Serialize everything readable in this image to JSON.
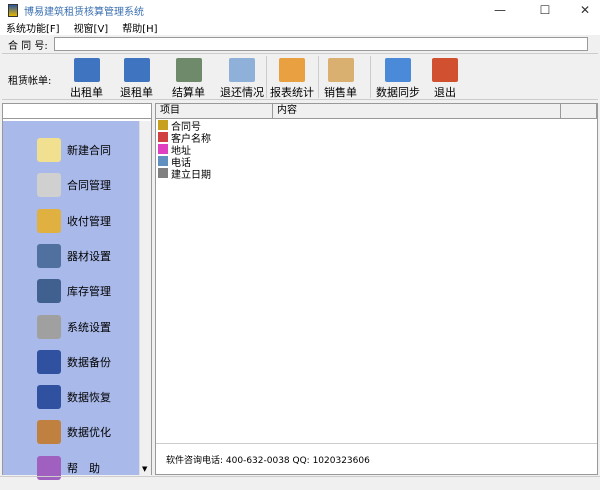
{
  "title": "博易建筑租赁核算管理系统",
  "window_controls": [
    "—",
    "☐",
    "✕"
  ],
  "menu": [
    "系统功能[F]",
    "视窗[V]",
    "帮助[H]"
  ],
  "contract": {
    "label": "合 同 号:",
    "value": ""
  },
  "toolbar": {
    "label": "租赁帐单:",
    "buttons": [
      {
        "label": "出租单",
        "color": "#3f74c0"
      },
      {
        "label": "退租单",
        "color": "#3f74c0"
      },
      {
        "label": "结算单",
        "color": "#6f8a6a"
      },
      {
        "label": "退还情况",
        "color": "#8fb0d8"
      },
      {
        "label": "报表统计",
        "color": "#e8a040"
      },
      {
        "label": "销售单",
        "color": "#d9b070"
      },
      {
        "label": "数据同步",
        "color": "#4a8ad8"
      },
      {
        "label": "退出",
        "color": "#d05030"
      }
    ]
  },
  "nav": [
    {
      "label": "新建合同",
      "color": "#f0e090"
    },
    {
      "label": "合同管理",
      "color": "#d0d0d0"
    },
    {
      "label": "收付管理",
      "color": "#e0b040"
    },
    {
      "label": "器材设置",
      "color": "#5070a0"
    },
    {
      "label": "库存管理",
      "color": "#406090"
    },
    {
      "label": "系统设置",
      "color": "#a0a0a0"
    },
    {
      "label": "数据备份",
      "color": "#3050a0"
    },
    {
      "label": "数据恢复",
      "color": "#3050a0"
    },
    {
      "label": "数据优化",
      "color": "#c08040"
    },
    {
      "label": "帮　助",
      "color": "#a060c0"
    }
  ],
  "table": {
    "headers": [
      "项目",
      "内容",
      ""
    ],
    "rows": [
      {
        "label": "合同号",
        "color": "#c8a020"
      },
      {
        "label": "客户名称",
        "color": "#d04040"
      },
      {
        "label": "地址",
        "color": "#e040c0"
      },
      {
        "label": "电话",
        "color": "#6090c0"
      },
      {
        "label": "建立日期",
        "color": "#808080"
      }
    ]
  },
  "info": "软件咨询电话: 400-632-0038   QQ: 1020323606"
}
